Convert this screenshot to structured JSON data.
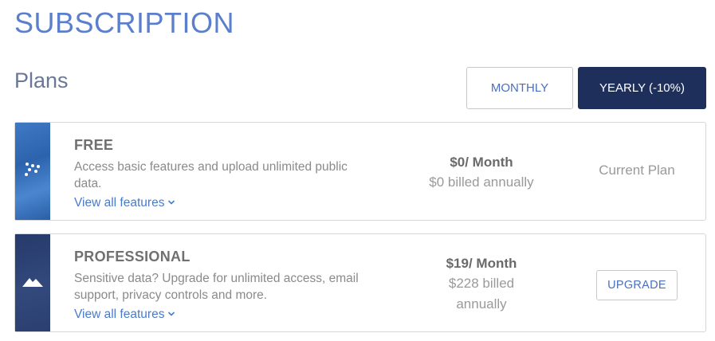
{
  "header": {
    "title": "SUBSCRIPTION",
    "section_title": "Plans"
  },
  "billing_toggle": {
    "monthly_label": "MONTHLY",
    "yearly_label": "YEARLY (-10%)",
    "selected": "yearly"
  },
  "plans": [
    {
      "name": "FREE",
      "description": "Access basic features and upload unlimited public data.",
      "features_link": "View all features",
      "price": "$0/ Month",
      "billed": "$0 billed annually",
      "status": "Current Plan",
      "icon": "dots-icon",
      "accent": "#3a73bf"
    },
    {
      "name": "PROFESSIONAL",
      "description": "Sensitive data? Upgrade for unlimited access, email support, privacy controls and more.",
      "features_link": "View all features",
      "price": "$19/ Month",
      "billed": "$228 billed annually",
      "action": "UPGRADE",
      "icon": "mountain-icon",
      "accent": "#2c4176"
    }
  ],
  "colors": {
    "title": "#5b7fcc",
    "primary_dark": "#1e2f5b",
    "link": "#4a7bc8"
  }
}
